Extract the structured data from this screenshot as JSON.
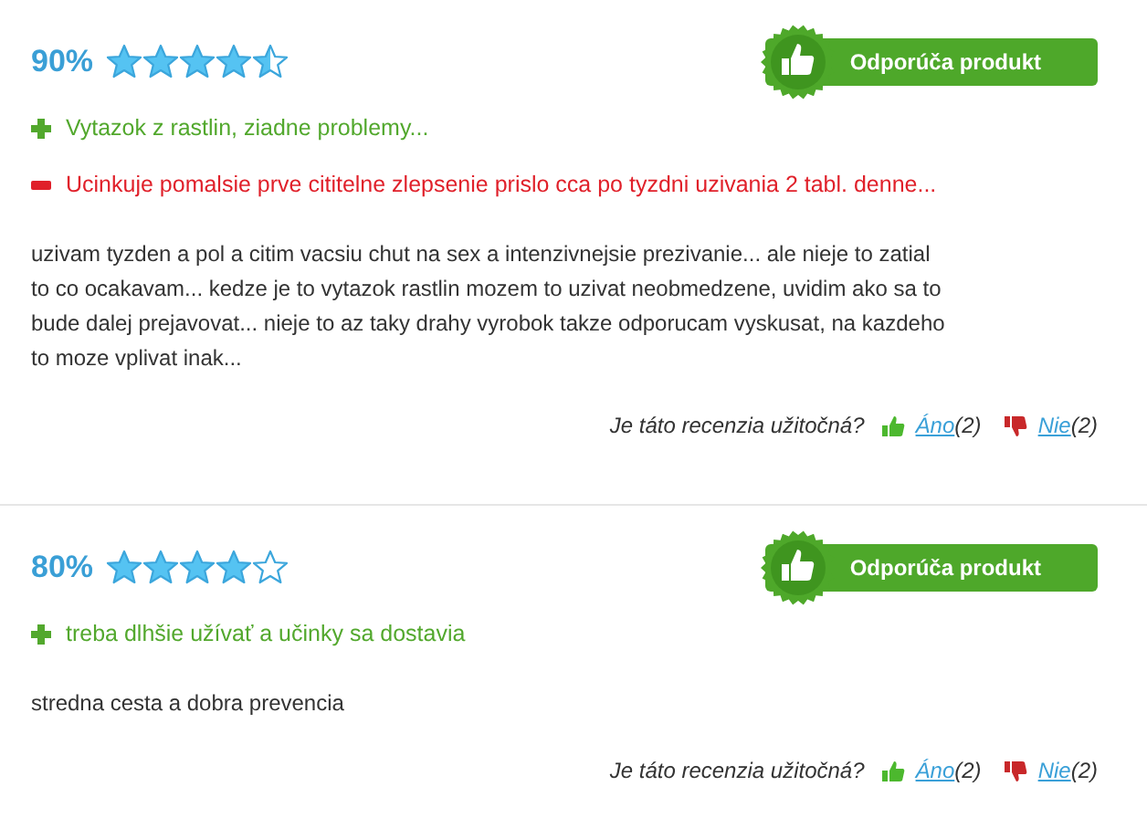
{
  "reviews": [
    {
      "percent": "90%",
      "stars": 4.5,
      "recommends": true,
      "badge": "Odporúča produkt",
      "points": [
        {
          "kind": "pro",
          "text": "Vytazok z rastlin, ziadne problemy..."
        },
        {
          "kind": "con",
          "text": "Ucinkuje pomalsie prve cititelne zlepsenie prislo cca po tyzdni uzivania 2 tabl. denne..."
        }
      ],
      "body": "uzivam tyzden a pol a citim vacsiu chut na sex a intenzivnejsie prezivanie... ale nieje to zatial to co ocakavam... kedze je to vytazok rastlin mozem to uzivat neobmedzene, uvidim ako sa to bude dalej prejavovat... nieje to az taky drahy vyrobok takze odporucam vyskusat, na kazdeho to moze vplivat inak...",
      "helpful": {
        "question": "Je táto recenzia užitočná?",
        "yes": "Áno",
        "yes_count": "(2)",
        "no": "Nie",
        "no_count": "(2)"
      }
    },
    {
      "percent": "80%",
      "stars": 4,
      "recommends": true,
      "badge": "Odporúča produkt",
      "points": [
        {
          "kind": "pro",
          "text": "treba dlhšie užívať a učinky sa dostavia"
        }
      ],
      "body": "stredna cesta a dobra prevencia",
      "helpful": {
        "question": "Je táto recenzia užitočná?",
        "yes": "Áno",
        "yes_count": "(2)",
        "no": "Nie",
        "no_count": "(2)"
      }
    }
  ]
}
